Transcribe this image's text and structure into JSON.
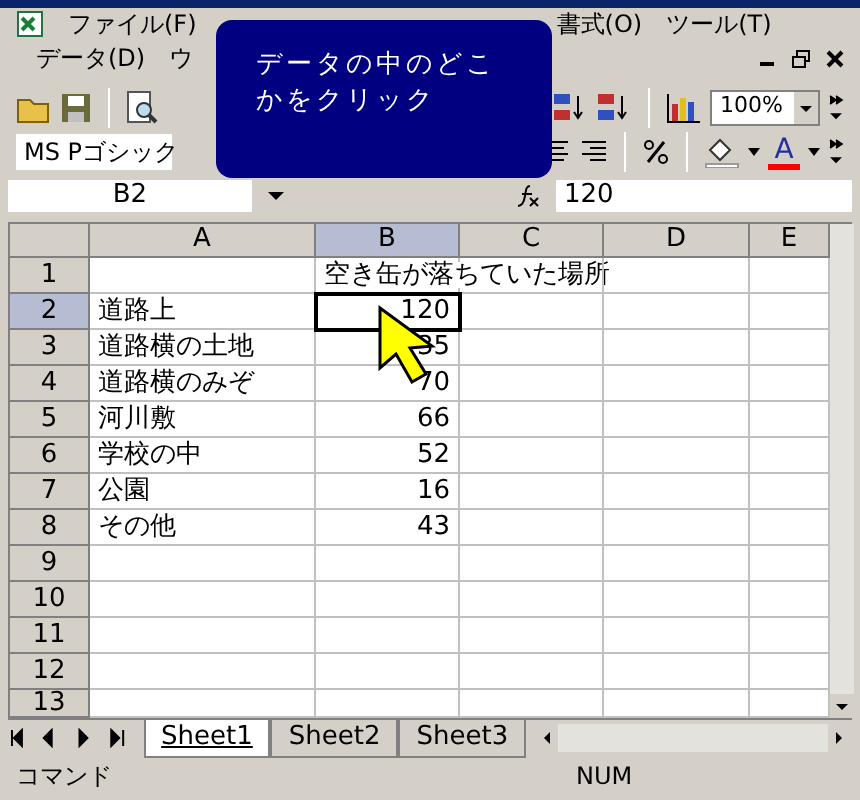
{
  "menu_rows": [
    [
      {
        "label": "ファイル(F)"
      },
      {
        "label": "書式(O)"
      },
      {
        "label": "ツール(T)"
      }
    ],
    [
      {
        "label": "データ(D)"
      },
      {
        "label": "ウ"
      }
    ]
  ],
  "toolbar": {
    "zoom": "100%"
  },
  "format_toolbar": {
    "font": "MS Pゴシック",
    "font_color_letter": "A"
  },
  "formula_bar": {
    "name_box": "B2",
    "value": "120"
  },
  "callout": {
    "text": "データの中のどこかをクリック"
  },
  "columns": [
    {
      "label": "A",
      "selected": false
    },
    {
      "label": "B",
      "selected": true
    },
    {
      "label": "C",
      "selected": false
    },
    {
      "label": "D",
      "selected": false
    },
    {
      "label": "E",
      "selected": false
    }
  ],
  "rows": [
    {
      "label": "1",
      "selected": false,
      "cells": [
        "",
        "空き缶が落ちていた場所"
      ]
    },
    {
      "label": "2",
      "selected": true,
      "cells": [
        "道路上",
        "120"
      ]
    },
    {
      "label": "3",
      "selected": false,
      "cells": [
        "道路横の土地",
        "35"
      ]
    },
    {
      "label": "4",
      "selected": false,
      "cells": [
        "道路横のみぞ",
        "70"
      ]
    },
    {
      "label": "5",
      "selected": false,
      "cells": [
        "河川敷",
        "66"
      ]
    },
    {
      "label": "6",
      "selected": false,
      "cells": [
        "学校の中",
        "52"
      ]
    },
    {
      "label": "7",
      "selected": false,
      "cells": [
        "公園",
        "16"
      ]
    },
    {
      "label": "8",
      "selected": false,
      "cells": [
        "その他",
        "43"
      ]
    },
    {
      "label": "9",
      "selected": false,
      "cells": []
    },
    {
      "label": "10",
      "selected": false,
      "cells": []
    },
    {
      "label": "11",
      "selected": false,
      "cells": []
    },
    {
      "label": "12",
      "selected": false,
      "cells": []
    },
    {
      "label": "13",
      "selected": false,
      "cells": []
    }
  ],
  "sheets": [
    {
      "label": "Sheet1",
      "selected": true
    },
    {
      "label": "Sheet2",
      "selected": false
    },
    {
      "label": "Sheet3",
      "selected": false
    }
  ],
  "status_bar": {
    "mode": "コマンド",
    "num": "NUM"
  }
}
